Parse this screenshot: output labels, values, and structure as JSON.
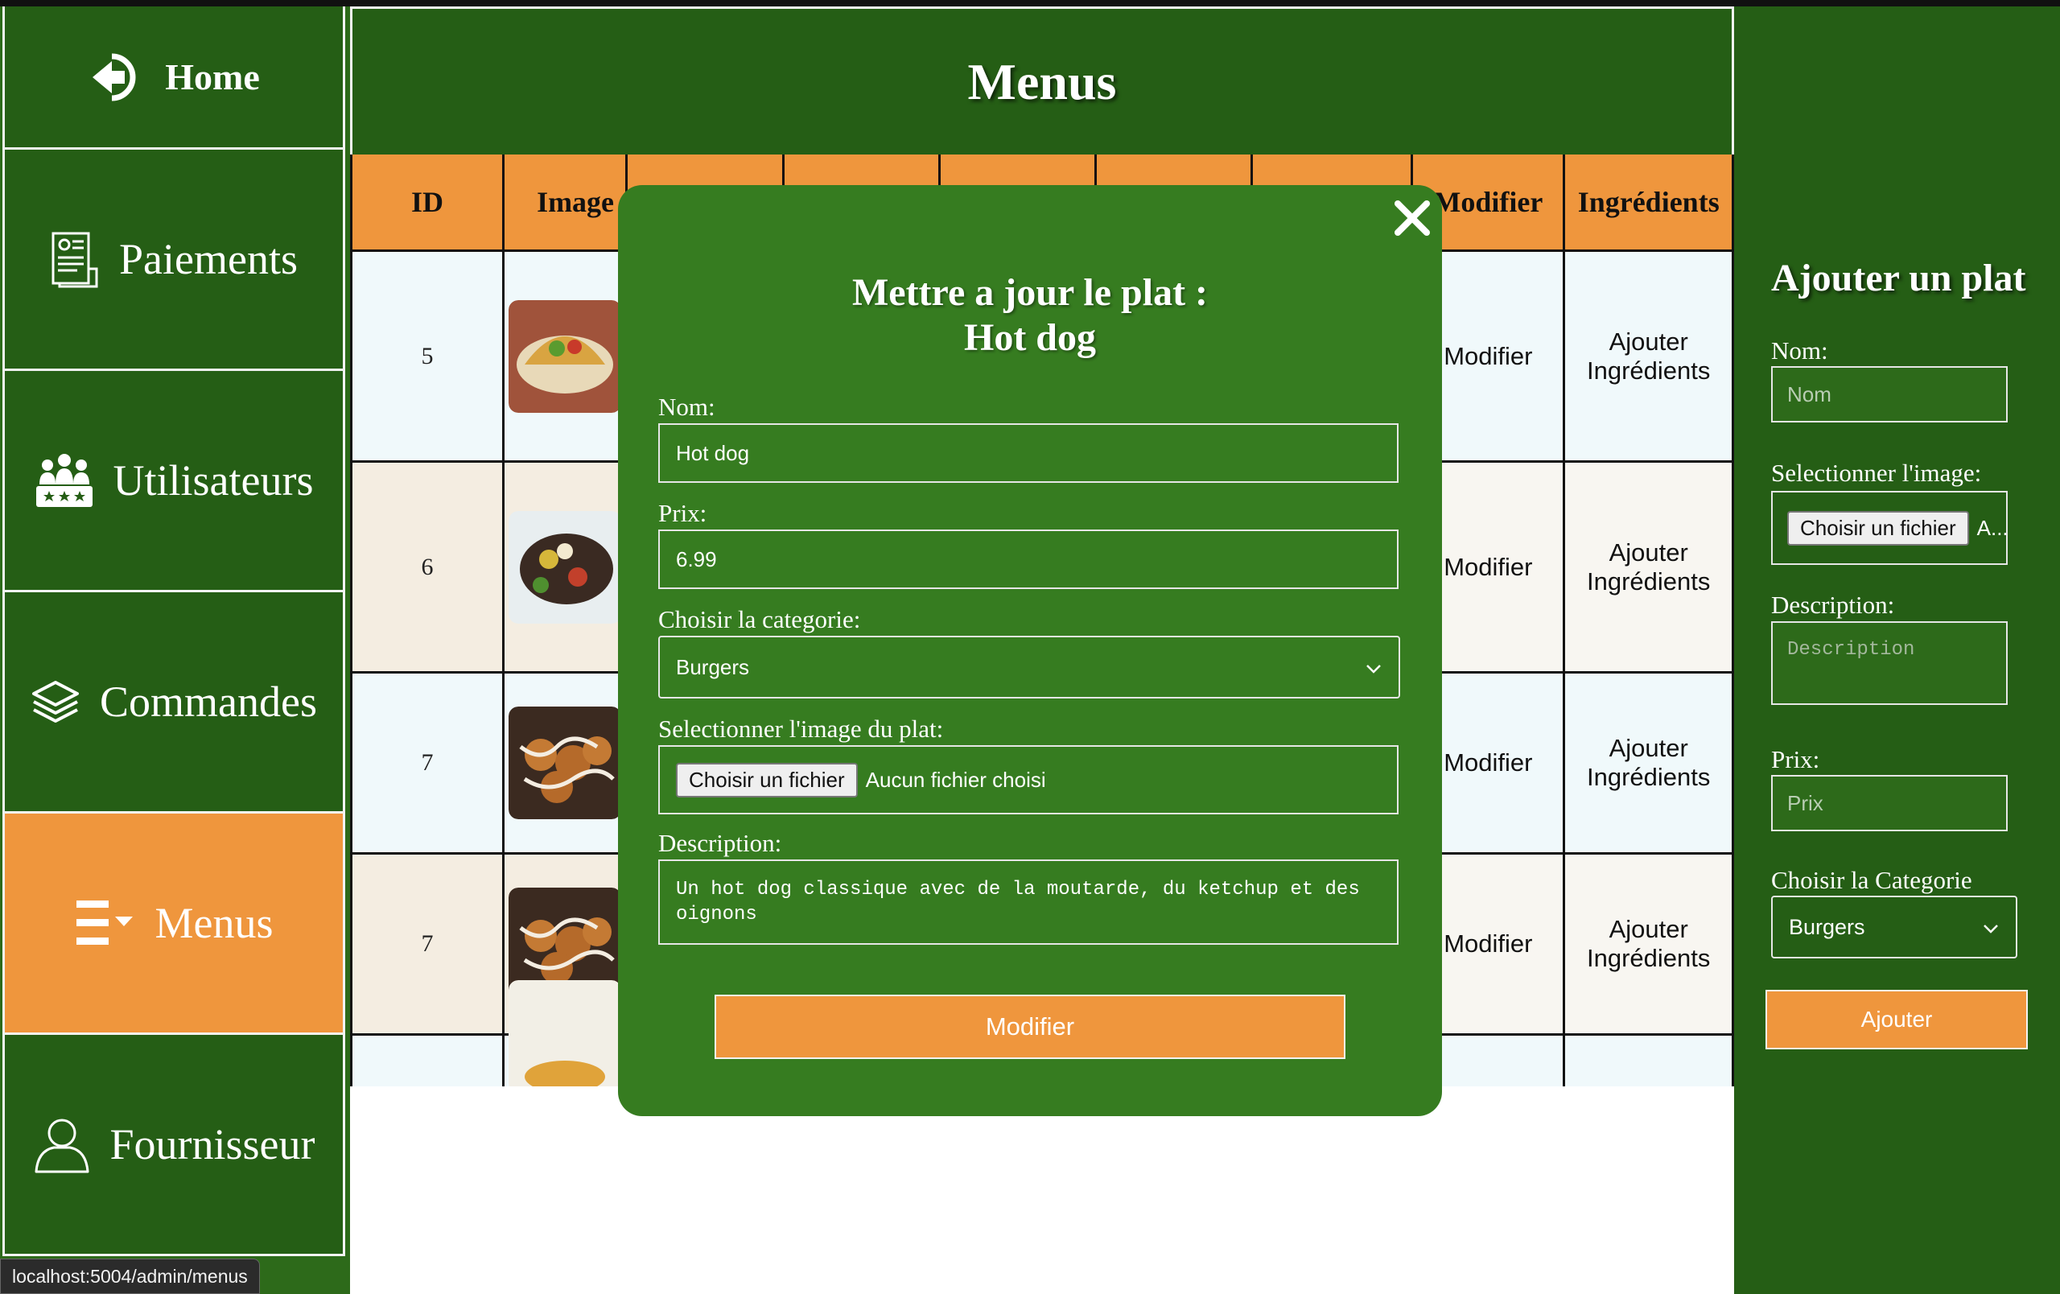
{
  "sidebar": {
    "items": [
      {
        "key": "home",
        "label": "Home",
        "icon": "back-arrow-circle-icon"
      },
      {
        "key": "paiements",
        "label": "Paiements",
        "icon": "invoice-icon"
      },
      {
        "key": "utilisateurs",
        "label": "Utilisateurs",
        "icon": "users-group-icon"
      },
      {
        "key": "commandes",
        "label": "Commandes",
        "icon": "layers-icon"
      },
      {
        "key": "menus",
        "label": "Menus",
        "icon": "menu-list-icon",
        "active": true
      },
      {
        "key": "fournisseur",
        "label": "Fournisseur",
        "icon": "user-outline-icon"
      }
    ]
  },
  "status_url": "localhost:5004/admin/menus",
  "main": {
    "title": "Menus",
    "table": {
      "headers": [
        "ID",
        "Image",
        "",
        "",
        "",
        "",
        "",
        "Modifier",
        "Ingrédients"
      ],
      "rows": [
        {
          "id": "5",
          "modify": "Modifier",
          "ingredients": "Ajouter Ingrédients"
        },
        {
          "id": "6",
          "modify": "Modifier",
          "ingredients": "Ajouter Ingrédients"
        },
        {
          "id": "7",
          "modify": "Modifier",
          "ingredients": "Ajouter Ingrédients"
        },
        {
          "id": "7",
          "modify": "Modifier",
          "ingredients": "Ajouter Ingrédients"
        },
        {
          "id": "",
          "modify": "",
          "ingredients": ""
        }
      ]
    }
  },
  "modal": {
    "title_line1": "Mettre a jour le plat :",
    "title_line2": "Hot dog",
    "nom_label": "Nom:",
    "nom_value": "Hot dog",
    "prix_label": "Prix:",
    "prix_value": "6.99",
    "categorie_label": "Choisir la categorie:",
    "categorie_value": "Burgers",
    "image_label": "Selectionner l'image du plat:",
    "file_button": "Choisir un fichier",
    "file_status": "Aucun fichier choisi",
    "description_label": "Description:",
    "description_value": "Un hot dog classique avec de la moutarde, du ketchup et des oignons",
    "submit": "Modifier"
  },
  "right_panel": {
    "title": "Ajouter un plat",
    "nom_label": "Nom:",
    "nom_placeholder": "Nom",
    "image_label": "Selectionner l'image:",
    "file_button": "Choisir un fichier",
    "file_status": "A...i",
    "description_label": "Description:",
    "description_placeholder": "Description",
    "prix_label": "Prix:",
    "prix_placeholder": "Prix",
    "categorie_label": "Choisir la Categorie",
    "categorie_value": "Burgers",
    "submit": "Ajouter"
  },
  "colors": {
    "sidebar_green": "#255e15",
    "modal_green": "#367c20",
    "accent_orange": "#ef963d"
  }
}
